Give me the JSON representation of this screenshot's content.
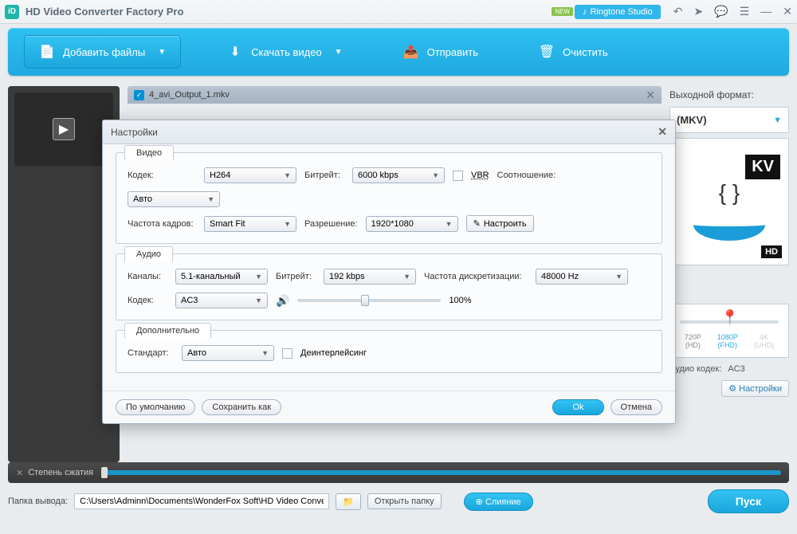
{
  "app": {
    "title": "HD Video Converter Factory Pro",
    "ringtone": "Ringtone Studio",
    "new": "NEW"
  },
  "toolbar": {
    "add": "Добавить файлы",
    "download": "Скачать видео",
    "send": "Отправить",
    "clear": "Очистить"
  },
  "file": {
    "name": "4_avi_Output_1.mkv"
  },
  "output": {
    "header": "Выходной формат:",
    "format": "(MKV)",
    "mkv": "KV",
    "hd": "HD",
    "res": {
      "r1": "720P",
      "r1s": "(HD)",
      "r2": "1080P",
      "r2s": "(FHD)",
      "r3": "4K",
      "r3s": "(UHD)"
    },
    "codec_label": "Аудио кодек:",
    "codec_value": "AC3",
    "settings": "Настройки"
  },
  "compress": {
    "label": "Степень сжатия"
  },
  "bottom": {
    "folder_label": "Папка вывода:",
    "path": "C:\\Users\\Adminn\\Documents\\WonderFox Soft\\HD Video Converter Factory P",
    "open": "Открыть папку",
    "merge": "Слияние",
    "run": "Пуск"
  },
  "modal": {
    "title": "Настройки",
    "video": {
      "tab": "Видео",
      "codec_l": "Кодек:",
      "codec": "H264",
      "bitrate_l": "Битрейт:",
      "bitrate": "6000 kbps",
      "vbr": "VBR",
      "ratio_l": "Соотношение:",
      "ratio": "Авто",
      "fps_l": "Частота кадров:",
      "fps": "Smart Fit",
      "res_l": "Разрешение:",
      "res": "1920*1080",
      "custom": "Настроить"
    },
    "audio": {
      "tab": "Аудио",
      "ch_l": "Каналы:",
      "ch": "5.1-канальный",
      "bitrate_l": "Битрейт:",
      "bitrate": "192 kbps",
      "sample_l": "Частота дискретизации:",
      "sample": "48000 Hz",
      "codec_l": "Кодек:",
      "codec": "AC3",
      "vol": "100%"
    },
    "extra": {
      "tab": "Дополнительно",
      "std_l": "Стандарт:",
      "std": "Авто",
      "deint": "Деинтерлейсинг"
    },
    "footer": {
      "defaults": "По умолчанию",
      "saveas": "Сохранить как",
      "ok": "Ok",
      "cancel": "Отмена"
    }
  }
}
